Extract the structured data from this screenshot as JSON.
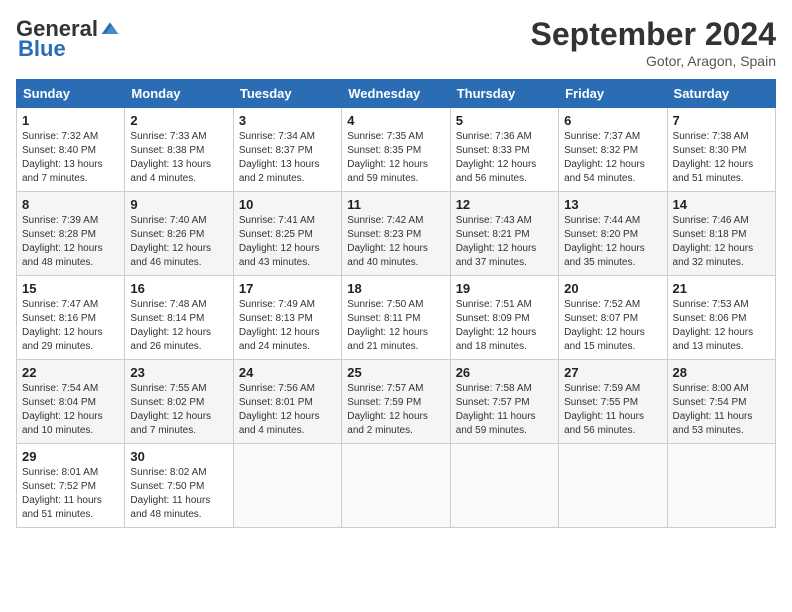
{
  "header": {
    "logo_general": "General",
    "logo_blue": "Blue",
    "month_title": "September 2024",
    "subtitle": "Gotor, Aragon, Spain"
  },
  "days_of_week": [
    "Sunday",
    "Monday",
    "Tuesday",
    "Wednesday",
    "Thursday",
    "Friday",
    "Saturday"
  ],
  "weeks": [
    [
      {
        "day": "1",
        "sunrise": "7:32 AM",
        "sunset": "8:40 PM",
        "daylight": "13 hours and 7 minutes."
      },
      {
        "day": "2",
        "sunrise": "7:33 AM",
        "sunset": "8:38 PM",
        "daylight": "13 hours and 4 minutes."
      },
      {
        "day": "3",
        "sunrise": "7:34 AM",
        "sunset": "8:37 PM",
        "daylight": "13 hours and 2 minutes."
      },
      {
        "day": "4",
        "sunrise": "7:35 AM",
        "sunset": "8:35 PM",
        "daylight": "12 hours and 59 minutes."
      },
      {
        "day": "5",
        "sunrise": "7:36 AM",
        "sunset": "8:33 PM",
        "daylight": "12 hours and 56 minutes."
      },
      {
        "day": "6",
        "sunrise": "7:37 AM",
        "sunset": "8:32 PM",
        "daylight": "12 hours and 54 minutes."
      },
      {
        "day": "7",
        "sunrise": "7:38 AM",
        "sunset": "8:30 PM",
        "daylight": "12 hours and 51 minutes."
      }
    ],
    [
      {
        "day": "8",
        "sunrise": "7:39 AM",
        "sunset": "8:28 PM",
        "daylight": "12 hours and 48 minutes."
      },
      {
        "day": "9",
        "sunrise": "7:40 AM",
        "sunset": "8:26 PM",
        "daylight": "12 hours and 46 minutes."
      },
      {
        "day": "10",
        "sunrise": "7:41 AM",
        "sunset": "8:25 PM",
        "daylight": "12 hours and 43 minutes."
      },
      {
        "day": "11",
        "sunrise": "7:42 AM",
        "sunset": "8:23 PM",
        "daylight": "12 hours and 40 minutes."
      },
      {
        "day": "12",
        "sunrise": "7:43 AM",
        "sunset": "8:21 PM",
        "daylight": "12 hours and 37 minutes."
      },
      {
        "day": "13",
        "sunrise": "7:44 AM",
        "sunset": "8:20 PM",
        "daylight": "12 hours and 35 minutes."
      },
      {
        "day": "14",
        "sunrise": "7:46 AM",
        "sunset": "8:18 PM",
        "daylight": "12 hours and 32 minutes."
      }
    ],
    [
      {
        "day": "15",
        "sunrise": "7:47 AM",
        "sunset": "8:16 PM",
        "daylight": "12 hours and 29 minutes."
      },
      {
        "day": "16",
        "sunrise": "7:48 AM",
        "sunset": "8:14 PM",
        "daylight": "12 hours and 26 minutes."
      },
      {
        "day": "17",
        "sunrise": "7:49 AM",
        "sunset": "8:13 PM",
        "daylight": "12 hours and 24 minutes."
      },
      {
        "day": "18",
        "sunrise": "7:50 AM",
        "sunset": "8:11 PM",
        "daylight": "12 hours and 21 minutes."
      },
      {
        "day": "19",
        "sunrise": "7:51 AM",
        "sunset": "8:09 PM",
        "daylight": "12 hours and 18 minutes."
      },
      {
        "day": "20",
        "sunrise": "7:52 AM",
        "sunset": "8:07 PM",
        "daylight": "12 hours and 15 minutes."
      },
      {
        "day": "21",
        "sunrise": "7:53 AM",
        "sunset": "8:06 PM",
        "daylight": "12 hours and 13 minutes."
      }
    ],
    [
      {
        "day": "22",
        "sunrise": "7:54 AM",
        "sunset": "8:04 PM",
        "daylight": "12 hours and 10 minutes."
      },
      {
        "day": "23",
        "sunrise": "7:55 AM",
        "sunset": "8:02 PM",
        "daylight": "12 hours and 7 minutes."
      },
      {
        "day": "24",
        "sunrise": "7:56 AM",
        "sunset": "8:01 PM",
        "daylight": "12 hours and 4 minutes."
      },
      {
        "day": "25",
        "sunrise": "7:57 AM",
        "sunset": "7:59 PM",
        "daylight": "12 hours and 2 minutes."
      },
      {
        "day": "26",
        "sunrise": "7:58 AM",
        "sunset": "7:57 PM",
        "daylight": "11 hours and 59 minutes."
      },
      {
        "day": "27",
        "sunrise": "7:59 AM",
        "sunset": "7:55 PM",
        "daylight": "11 hours and 56 minutes."
      },
      {
        "day": "28",
        "sunrise": "8:00 AM",
        "sunset": "7:54 PM",
        "daylight": "11 hours and 53 minutes."
      }
    ],
    [
      {
        "day": "29",
        "sunrise": "8:01 AM",
        "sunset": "7:52 PM",
        "daylight": "11 hours and 51 minutes."
      },
      {
        "day": "30",
        "sunrise": "8:02 AM",
        "sunset": "7:50 PM",
        "daylight": "11 hours and 48 minutes."
      },
      null,
      null,
      null,
      null,
      null
    ]
  ],
  "labels": {
    "sunrise": "Sunrise: ",
    "sunset": "Sunset: ",
    "daylight": "Daylight: "
  }
}
